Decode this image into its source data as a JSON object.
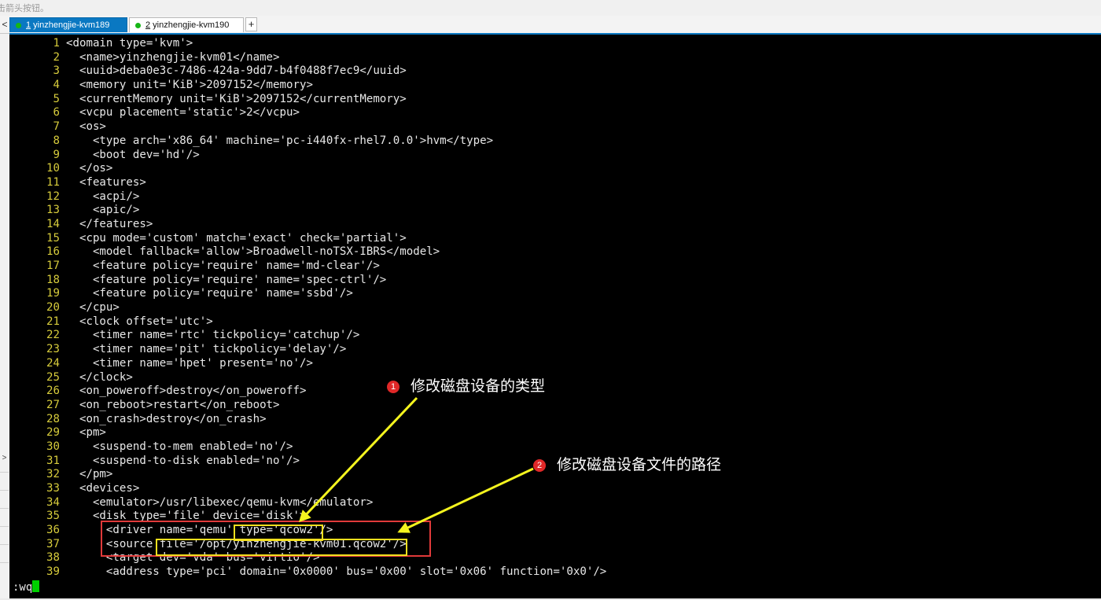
{
  "window": {
    "hint_text": "击箭头按钮。"
  },
  "tabs": [
    {
      "number": "1",
      "label": " yinzhengjie-kvm189",
      "active": true
    },
    {
      "number": "2",
      "label": " yinzhengjie-kvm190",
      "active": false
    }
  ],
  "tab_add_label": "+",
  "tab_nav_label": "<",
  "side_marks": [
    ">"
  ],
  "editor": {
    "lines": [
      {
        "n": "1",
        "text": "<domain type='kvm'>"
      },
      {
        "n": "2",
        "text": "  <name>yinzhengjie-kvm01</name>"
      },
      {
        "n": "3",
        "text": "  <uuid>deba0e3c-7486-424a-9dd7-b4f0488f7ec9</uuid>"
      },
      {
        "n": "4",
        "text": "  <memory unit='KiB'>2097152</memory>"
      },
      {
        "n": "5",
        "text": "  <currentMemory unit='KiB'>2097152</currentMemory>"
      },
      {
        "n": "6",
        "text": "  <vcpu placement='static'>2</vcpu>"
      },
      {
        "n": "7",
        "text": "  <os>"
      },
      {
        "n": "8",
        "text": "    <type arch='x86_64' machine='pc-i440fx-rhel7.0.0'>hvm</type>"
      },
      {
        "n": "9",
        "text": "    <boot dev='hd'/>"
      },
      {
        "n": "10",
        "text": "  </os>"
      },
      {
        "n": "11",
        "text": "  <features>"
      },
      {
        "n": "12",
        "text": "    <acpi/>"
      },
      {
        "n": "13",
        "text": "    <apic/>"
      },
      {
        "n": "14",
        "text": "  </features>"
      },
      {
        "n": "15",
        "text": "  <cpu mode='custom' match='exact' check='partial'>"
      },
      {
        "n": "16",
        "text": "    <model fallback='allow'>Broadwell-noTSX-IBRS</model>"
      },
      {
        "n": "17",
        "text": "    <feature policy='require' name='md-clear'/>"
      },
      {
        "n": "18",
        "text": "    <feature policy='require' name='spec-ctrl'/>"
      },
      {
        "n": "19",
        "text": "    <feature policy='require' name='ssbd'/>"
      },
      {
        "n": "20",
        "text": "  </cpu>"
      },
      {
        "n": "21",
        "text": "  <clock offset='utc'>"
      },
      {
        "n": "22",
        "text": "    <timer name='rtc' tickpolicy='catchup'/>"
      },
      {
        "n": "23",
        "text": "    <timer name='pit' tickpolicy='delay'/>"
      },
      {
        "n": "24",
        "text": "    <timer name='hpet' present='no'/>"
      },
      {
        "n": "25",
        "text": "  </clock>"
      },
      {
        "n": "26",
        "text": "  <on_poweroff>destroy</on_poweroff>"
      },
      {
        "n": "27",
        "text": "  <on_reboot>restart</on_reboot>"
      },
      {
        "n": "28",
        "text": "  <on_crash>destroy</on_crash>"
      },
      {
        "n": "29",
        "text": "  <pm>"
      },
      {
        "n": "30",
        "text": "    <suspend-to-mem enabled='no'/>"
      },
      {
        "n": "31",
        "text": "    <suspend-to-disk enabled='no'/>"
      },
      {
        "n": "32",
        "text": "  </pm>"
      },
      {
        "n": "33",
        "text": "  <devices>"
      },
      {
        "n": "34",
        "text": "    <emulator>/usr/libexec/qemu-kvm</emulator>"
      },
      {
        "n": "35",
        "text": "    <disk type='file' device='disk'>"
      },
      {
        "n": "36",
        "text": "      <driver name='qemu' type='qcow2'/>"
      },
      {
        "n": "37",
        "text": "      <source file='/opt/yinzhengjie-kvm01.qcow2'/>"
      },
      {
        "n": "38",
        "text": "      <target dev='vda' bus='virtio'/>"
      },
      {
        "n": "39",
        "text": "      <address type='pci' domain='0x0000' bus='0x00' slot='0x06' function='0x0'/>"
      }
    ],
    "command_line": ":wq"
  },
  "annotations": [
    {
      "badge": "1",
      "text": "修改磁盘设备的类型"
    },
    {
      "badge": "2",
      "text": "修改磁盘设备文件的路径"
    }
  ],
  "colors": {
    "tab_active_bg": "#0a78c2",
    "line_number": "#d7cc3c",
    "highlight_red": "#e03a3a",
    "highlight_yellow": "#f4e01e",
    "cursor": "#00d000",
    "badge": "#e02828"
  }
}
